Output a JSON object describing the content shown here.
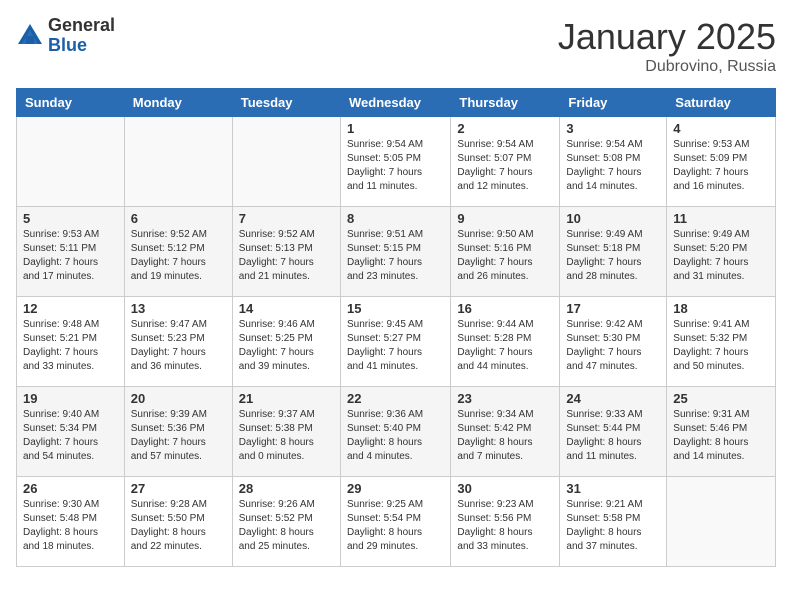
{
  "header": {
    "logo_general": "General",
    "logo_blue": "Blue",
    "month_title": "January 2025",
    "location": "Dubrovino, Russia"
  },
  "weekdays": [
    "Sunday",
    "Monday",
    "Tuesday",
    "Wednesday",
    "Thursday",
    "Friday",
    "Saturday"
  ],
  "weeks": [
    [
      {
        "day": "",
        "info": ""
      },
      {
        "day": "",
        "info": ""
      },
      {
        "day": "",
        "info": ""
      },
      {
        "day": "1",
        "info": "Sunrise: 9:54 AM\nSunset: 5:05 PM\nDaylight: 7 hours\nand 11 minutes."
      },
      {
        "day": "2",
        "info": "Sunrise: 9:54 AM\nSunset: 5:07 PM\nDaylight: 7 hours\nand 12 minutes."
      },
      {
        "day": "3",
        "info": "Sunrise: 9:54 AM\nSunset: 5:08 PM\nDaylight: 7 hours\nand 14 minutes."
      },
      {
        "day": "4",
        "info": "Sunrise: 9:53 AM\nSunset: 5:09 PM\nDaylight: 7 hours\nand 16 minutes."
      }
    ],
    [
      {
        "day": "5",
        "info": "Sunrise: 9:53 AM\nSunset: 5:11 PM\nDaylight: 7 hours\nand 17 minutes."
      },
      {
        "day": "6",
        "info": "Sunrise: 9:52 AM\nSunset: 5:12 PM\nDaylight: 7 hours\nand 19 minutes."
      },
      {
        "day": "7",
        "info": "Sunrise: 9:52 AM\nSunset: 5:13 PM\nDaylight: 7 hours\nand 21 minutes."
      },
      {
        "day": "8",
        "info": "Sunrise: 9:51 AM\nSunset: 5:15 PM\nDaylight: 7 hours\nand 23 minutes."
      },
      {
        "day": "9",
        "info": "Sunrise: 9:50 AM\nSunset: 5:16 PM\nDaylight: 7 hours\nand 26 minutes."
      },
      {
        "day": "10",
        "info": "Sunrise: 9:49 AM\nSunset: 5:18 PM\nDaylight: 7 hours\nand 28 minutes."
      },
      {
        "day": "11",
        "info": "Sunrise: 9:49 AM\nSunset: 5:20 PM\nDaylight: 7 hours\nand 31 minutes."
      }
    ],
    [
      {
        "day": "12",
        "info": "Sunrise: 9:48 AM\nSunset: 5:21 PM\nDaylight: 7 hours\nand 33 minutes."
      },
      {
        "day": "13",
        "info": "Sunrise: 9:47 AM\nSunset: 5:23 PM\nDaylight: 7 hours\nand 36 minutes."
      },
      {
        "day": "14",
        "info": "Sunrise: 9:46 AM\nSunset: 5:25 PM\nDaylight: 7 hours\nand 39 minutes."
      },
      {
        "day": "15",
        "info": "Sunrise: 9:45 AM\nSunset: 5:27 PM\nDaylight: 7 hours\nand 41 minutes."
      },
      {
        "day": "16",
        "info": "Sunrise: 9:44 AM\nSunset: 5:28 PM\nDaylight: 7 hours\nand 44 minutes."
      },
      {
        "day": "17",
        "info": "Sunrise: 9:42 AM\nSunset: 5:30 PM\nDaylight: 7 hours\nand 47 minutes."
      },
      {
        "day": "18",
        "info": "Sunrise: 9:41 AM\nSunset: 5:32 PM\nDaylight: 7 hours\nand 50 minutes."
      }
    ],
    [
      {
        "day": "19",
        "info": "Sunrise: 9:40 AM\nSunset: 5:34 PM\nDaylight: 7 hours\nand 54 minutes."
      },
      {
        "day": "20",
        "info": "Sunrise: 9:39 AM\nSunset: 5:36 PM\nDaylight: 7 hours\nand 57 minutes."
      },
      {
        "day": "21",
        "info": "Sunrise: 9:37 AM\nSunset: 5:38 PM\nDaylight: 8 hours\nand 0 minutes."
      },
      {
        "day": "22",
        "info": "Sunrise: 9:36 AM\nSunset: 5:40 PM\nDaylight: 8 hours\nand 4 minutes."
      },
      {
        "day": "23",
        "info": "Sunrise: 9:34 AM\nSunset: 5:42 PM\nDaylight: 8 hours\nand 7 minutes."
      },
      {
        "day": "24",
        "info": "Sunrise: 9:33 AM\nSunset: 5:44 PM\nDaylight: 8 hours\nand 11 minutes."
      },
      {
        "day": "25",
        "info": "Sunrise: 9:31 AM\nSunset: 5:46 PM\nDaylight: 8 hours\nand 14 minutes."
      }
    ],
    [
      {
        "day": "26",
        "info": "Sunrise: 9:30 AM\nSunset: 5:48 PM\nDaylight: 8 hours\nand 18 minutes."
      },
      {
        "day": "27",
        "info": "Sunrise: 9:28 AM\nSunset: 5:50 PM\nDaylight: 8 hours\nand 22 minutes."
      },
      {
        "day": "28",
        "info": "Sunrise: 9:26 AM\nSunset: 5:52 PM\nDaylight: 8 hours\nand 25 minutes."
      },
      {
        "day": "29",
        "info": "Sunrise: 9:25 AM\nSunset: 5:54 PM\nDaylight: 8 hours\nand 29 minutes."
      },
      {
        "day": "30",
        "info": "Sunrise: 9:23 AM\nSunset: 5:56 PM\nDaylight: 8 hours\nand 33 minutes."
      },
      {
        "day": "31",
        "info": "Sunrise: 9:21 AM\nSunset: 5:58 PM\nDaylight: 8 hours\nand 37 minutes."
      },
      {
        "day": "",
        "info": ""
      }
    ]
  ]
}
